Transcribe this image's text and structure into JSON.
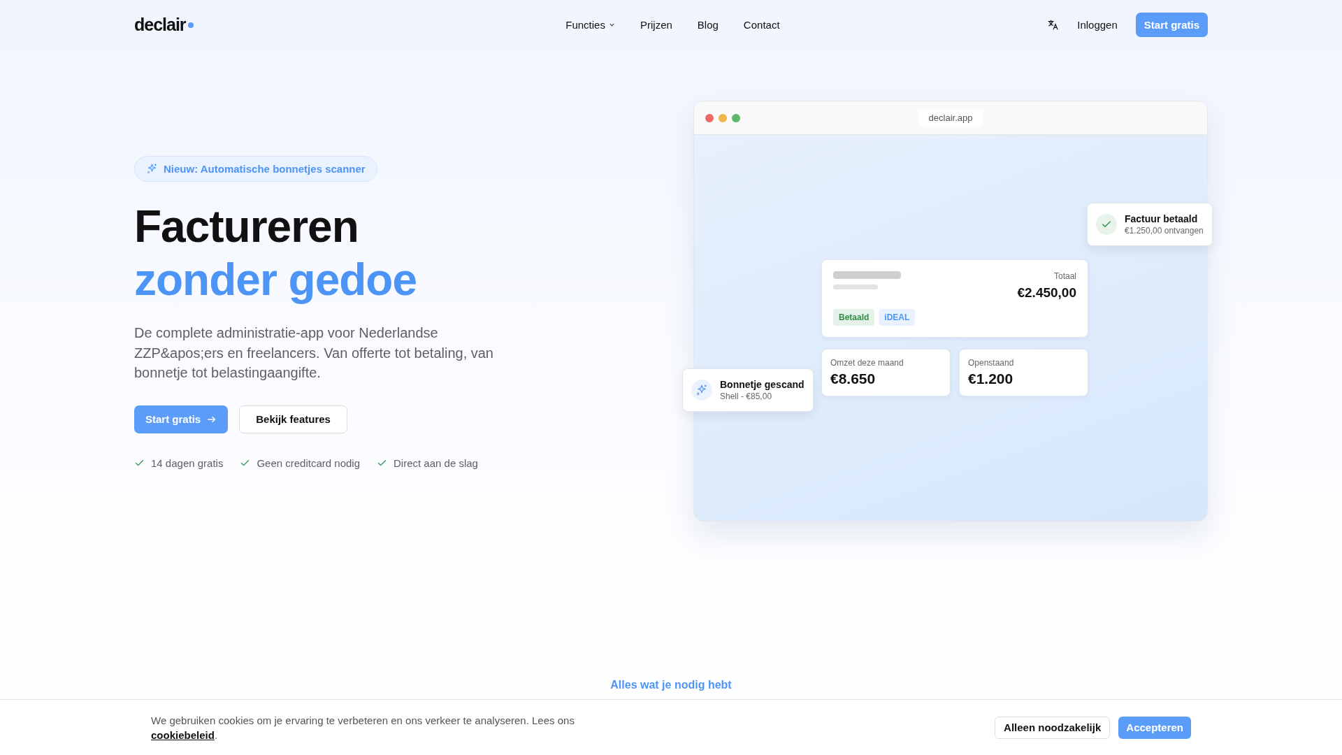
{
  "nav": {
    "logo": "declair",
    "links": [
      {
        "label": "Functies",
        "dropdown": true
      },
      {
        "label": "Prijzen",
        "dropdown": false
      },
      {
        "label": "Blog",
        "dropdown": false
      },
      {
        "label": "Contact",
        "dropdown": false
      }
    ],
    "login": "Inloggen",
    "cta": "Start gratis"
  },
  "hero": {
    "badge": "Nieuw: Automatische bonnetjes scanner",
    "title_line_1": "Factureren",
    "title_line_2": "zonder gedoe",
    "description": "De complete administratie-app voor Nederlandse ZZP&apos;ers en freelancers. Van offerte tot betaling, van bonnetje tot belastingaangifte.",
    "primary_button": "Start gratis",
    "secondary_button": "Bekijk features",
    "checks": [
      "14 dagen gratis",
      "Geen creditcard nodig",
      "Direct aan de slag"
    ]
  },
  "mockup": {
    "url": "declair.app",
    "invoice": {
      "total_label": "Totaal",
      "total": "€2.450,00",
      "tags": [
        {
          "label": "Betaald",
          "color": "#2f8f46"
        },
        {
          "label": "iDEAL",
          "color": "#4d94f7"
        }
      ]
    },
    "stats": [
      {
        "label": "Omzet deze maand",
        "value": "€8.650"
      },
      {
        "label": "Openstaand",
        "value": "€1.200"
      }
    ],
    "notifications": [
      {
        "kind": "paid",
        "title": "Factuur betaald",
        "subtitle": "€1.250,00 ontvangen"
      },
      {
        "kind": "scan",
        "title": "Bonnetje gescand",
        "subtitle": "Shell - €85,00"
      }
    ]
  },
  "section": {
    "eyebrow": "Alles wat je nodig hebt"
  },
  "cookie_banner": {
    "text": "We gebruiken cookies om je ervaring te verbeteren en ons verkeer te analyseren. Lees ons",
    "link": "cookiebeleid",
    "after_link": ".",
    "buttons": [
      {
        "label": "Alleen noodzakelijk",
        "kind": "secondary"
      },
      {
        "label": "Accepteren",
        "kind": "primary"
      }
    ]
  }
}
